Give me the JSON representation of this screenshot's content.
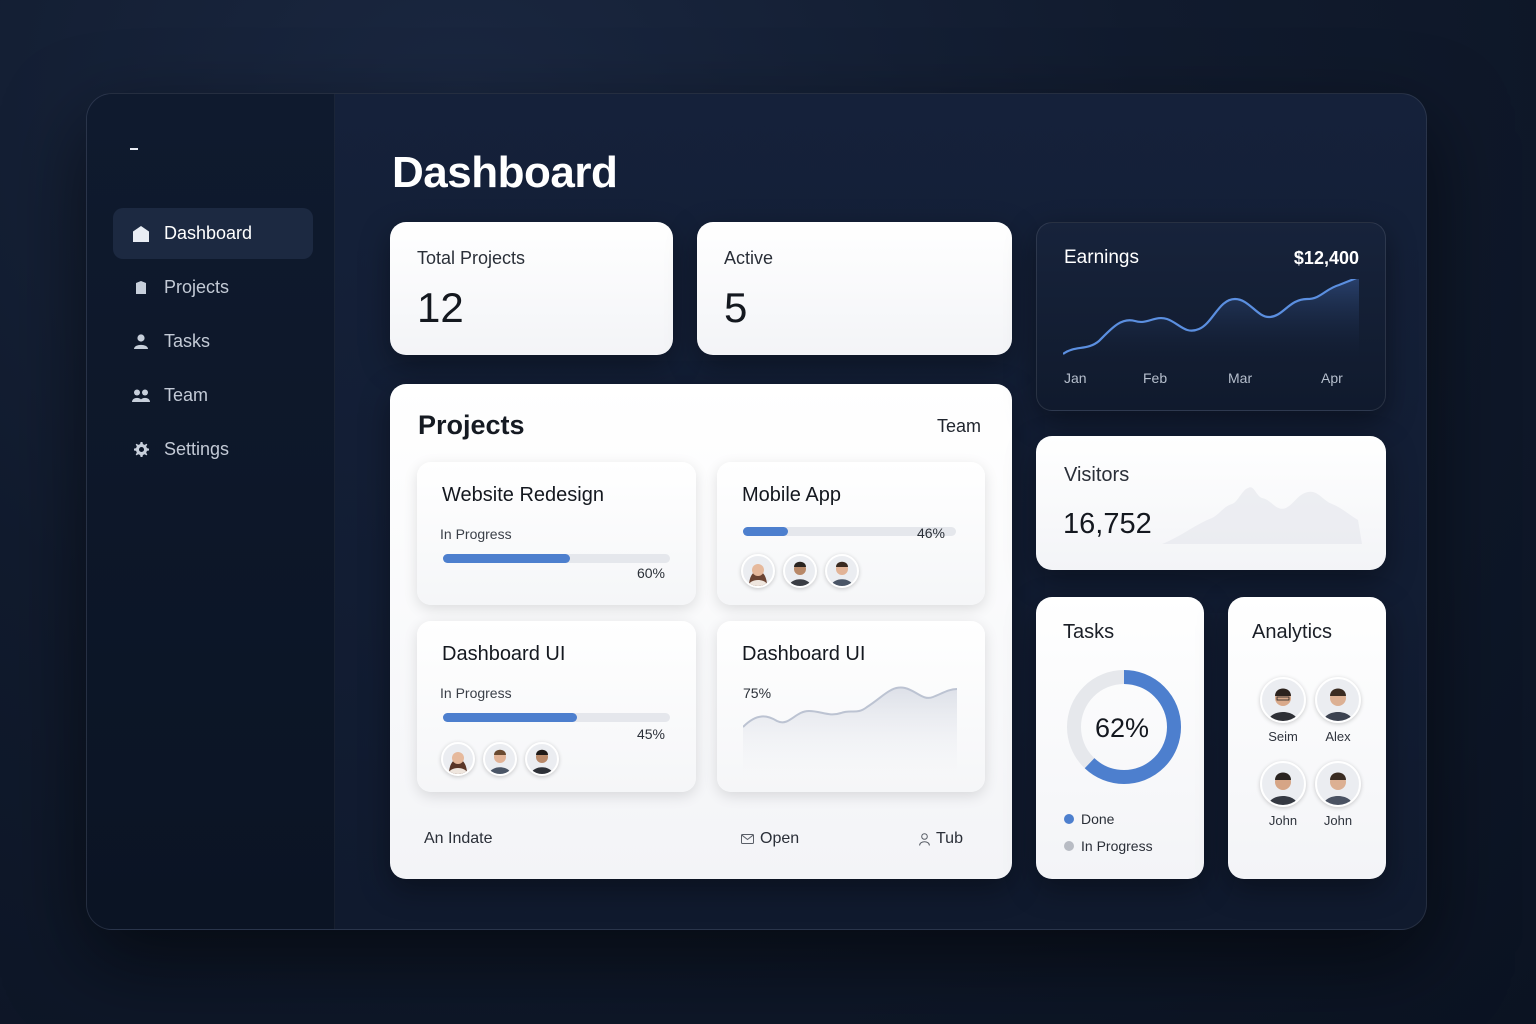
{
  "sidebar": {
    "items": [
      {
        "label": "Dashboard",
        "icon": "home-icon",
        "active": true
      },
      {
        "label": "Projects",
        "icon": "folder-icon"
      },
      {
        "label": "Tasks",
        "icon": "user-icon"
      },
      {
        "label": "Team",
        "icon": "users-icon"
      },
      {
        "label": "Settings",
        "icon": "gear-icon"
      }
    ]
  },
  "page": {
    "title": "Dashboard"
  },
  "stats": {
    "total_projects": {
      "label": "Total Projects",
      "value": "12"
    },
    "active": {
      "label": "Active",
      "value": "5"
    }
  },
  "projects": {
    "title": "Projects",
    "team_link": "Team",
    "cards": [
      {
        "title": "Website Redesign",
        "status": "In Progress",
        "percent_label": "60%",
        "progress": 0.56
      },
      {
        "title": "Mobile App",
        "percent_label": "46%",
        "progress": 0.21
      },
      {
        "title": "Dashboard UI",
        "status": "In Progress",
        "percent_label": "45%",
        "progress": 0.59
      },
      {
        "title": "Dashboard UI",
        "percent_label": "75%"
      }
    ],
    "footer": {
      "left": "An Indate",
      "open": "Open",
      "tub": "Tub"
    }
  },
  "earnings": {
    "title": "Earnings",
    "amount": "$12,400",
    "months": [
      "Jan",
      "Feb",
      "Mar",
      "Apr"
    ],
    "line_color": "#5b8fe0"
  },
  "visitors": {
    "title": "Visitors",
    "value": "16,752"
  },
  "tasks": {
    "title": "Tasks",
    "percent_label": "62%",
    "done_fraction": 0.62,
    "legend": [
      {
        "label": "Done",
        "color": "#4d7fce"
      },
      {
        "label": "In Progress",
        "color": "#b8bcc4"
      }
    ]
  },
  "analytics": {
    "title": "Analytics",
    "members": [
      "Seim",
      "Alex",
      "John",
      "John"
    ]
  },
  "colors": {
    "accent": "#4d7fce",
    "background": "#111b2e"
  }
}
